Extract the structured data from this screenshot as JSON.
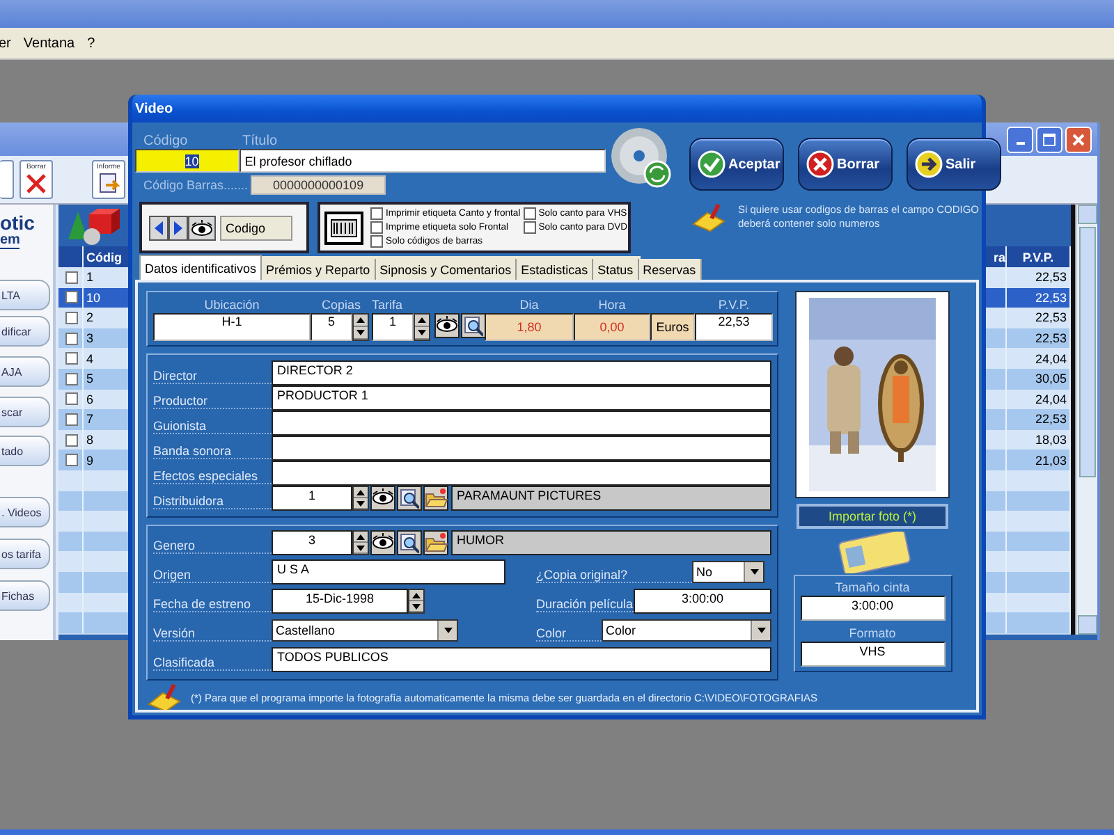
{
  "app": {
    "menu": [
      {
        "label": "er"
      },
      {
        "label": "Ventana"
      },
      {
        "label": "?"
      }
    ]
  },
  "background_window": {
    "toolbar": [
      {
        "label": "Borrar",
        "kind": "delete"
      },
      {
        "label": "Informe",
        "kind": "report"
      }
    ],
    "logo": {
      "line_1": "otic",
      "line_2": "em"
    },
    "side_buttons": [
      {
        "label": "LTA"
      },
      {
        "label": "dificar"
      },
      {
        "label": "AJA"
      },
      {
        "label": "scar"
      },
      {
        "label": "tado"
      },
      {
        "label": ". Videos"
      },
      {
        "label": "os tarifa"
      },
      {
        "label": "Fichas"
      }
    ],
    "table": {
      "columns": [
        "Códig",
        "ra",
        "P.V.P."
      ],
      "rows": [
        {
          "code": "1",
          "pvp": "22,53",
          "checked": false,
          "selected": false
        },
        {
          "code": "10",
          "pvp": "22,53",
          "checked": false,
          "selected": true
        },
        {
          "code": "2",
          "pvp": "22,53",
          "checked": false,
          "selected": false
        },
        {
          "code": "3",
          "pvp": "22,53",
          "checked": false,
          "selected": false
        },
        {
          "code": "4",
          "pvp": "24,04",
          "checked": false,
          "selected": false
        },
        {
          "code": "5",
          "pvp": "30,05",
          "checked": false,
          "selected": false
        },
        {
          "code": "6",
          "pvp": "24,04",
          "checked": false,
          "selected": false
        },
        {
          "code": "7",
          "pvp": "22,53",
          "checked": false,
          "selected": false
        },
        {
          "code": "8",
          "pvp": "18,03",
          "checked": false,
          "selected": false
        },
        {
          "code": "9",
          "pvp": "21,03",
          "checked": false,
          "selected": false
        }
      ]
    }
  },
  "dialog": {
    "title": "Video",
    "codigo": {
      "label": "Código",
      "value": "10",
      "highlighted": true
    },
    "titulo": {
      "label": "Título",
      "value": "El profesor chiflado"
    },
    "barcode": {
      "label": "Código Barras.......",
      "value": "0000000000109"
    },
    "actions": [
      {
        "label": "Aceptar",
        "kind": "accept"
      },
      {
        "label": "Borrar",
        "kind": "delete"
      },
      {
        "label": "Salir",
        "kind": "exit"
      }
    ],
    "nav": {
      "label": "Codigo"
    },
    "print_options": [
      {
        "label": "Imprimir etiqueta Canto y frontal",
        "checked": false
      },
      {
        "label": "Solo canto para VHS",
        "checked": false
      },
      {
        "label": "Imprime etiqueta solo Frontal",
        "checked": false
      },
      {
        "label": "Solo canto para DVD",
        "checked": false
      },
      {
        "label": "Solo códigos de barras",
        "checked": false
      }
    ],
    "barcode_note": [
      "Si quiere usar codigos de barras el campo CODIGO",
      "deberá contener solo numeros"
    ],
    "tabs": [
      {
        "label": "Datos identificativos",
        "selected": true
      },
      {
        "label": "Prémios y Reparto",
        "selected": false
      },
      {
        "label": "Sipnosis y Comentarios",
        "selected": false
      },
      {
        "label": "Estadisticas",
        "selected": false
      },
      {
        "label": "Status",
        "selected": false
      },
      {
        "label": "Reservas",
        "selected": false
      }
    ],
    "location": {
      "columns": [
        "Ubicación",
        "Copias",
        "Tarifa",
        "Dia",
        "Hora",
        "P.V.P."
      ],
      "ubicacion": "H-1",
      "copias": "5",
      "tarifa": "1",
      "dia": "1,80",
      "hora": "0,00",
      "currency": "Euros",
      "pvp": "22,53"
    },
    "credits": [
      {
        "label": "Director",
        "value": "DIRECTOR 2"
      },
      {
        "label": "Productor",
        "value": "PRODUCTOR 1"
      },
      {
        "label": "Guionista"
      },
      {
        "label": "Banda sonora"
      },
      {
        "label": "Efectos especiales"
      }
    ],
    "distribuidora": {
      "label": "Distribuidora",
      "code": "1",
      "name": "PARAMAUNT PICTURES"
    },
    "genero": {
      "label": "Genero",
      "code": "3",
      "name": "HUMOR"
    },
    "origen": {
      "label": "Origen",
      "value": "U S A"
    },
    "copia_original": {
      "label": "¿Copia original?",
      "value": "No"
    },
    "fecha_estreno": {
      "label": "Fecha de estreno",
      "value": "15-Dic-1998"
    },
    "duracion": {
      "label": "Duración película",
      "value": "3:00:00"
    },
    "version": {
      "label": "Versión",
      "value": "Castellano"
    },
    "color": {
      "label": "Color",
      "value": "Color"
    },
    "clasificada": {
      "label": "Clasificada",
      "value": "TODOS PUBLICOS"
    },
    "import_photo": "Importar foto (*)",
    "tape": {
      "size_label": "Tamaño cinta",
      "size": "3:00:00",
      "format_label": "Formato",
      "format": "VHS"
    },
    "footer_note": "(*) Para que el programa importe la fotografía automaticamente la misma debe ser guardada en el directorio C:\\VIDEO\\FOTOGRAFIAS"
  }
}
